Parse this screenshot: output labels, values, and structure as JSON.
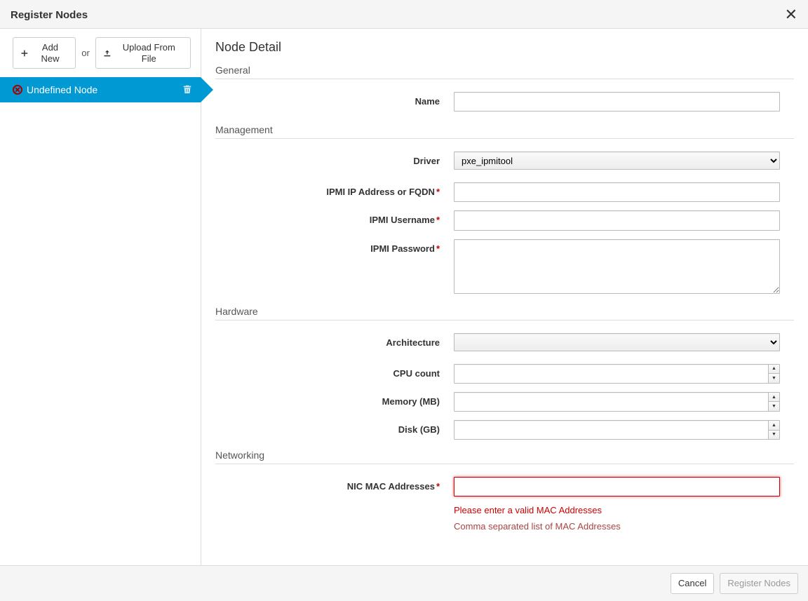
{
  "header": {
    "title": "Register Nodes"
  },
  "sidebar": {
    "add_label": "Add New",
    "or_label": "or",
    "upload_label": "Upload From File",
    "node_label": "Undefined Node"
  },
  "detail": {
    "title": "Node Detail",
    "sections": {
      "general": "General",
      "management": "Management",
      "hardware": "Hardware",
      "networking": "Networking"
    },
    "fields": {
      "name": {
        "label": "Name",
        "value": ""
      },
      "driver": {
        "label": "Driver",
        "value": "pxe_ipmitool"
      },
      "ipmi_address": {
        "label": "IPMI IP Address or FQDN",
        "value": ""
      },
      "ipmi_user": {
        "label": "IPMI Username",
        "value": ""
      },
      "ipmi_pass": {
        "label": "IPMI Password",
        "value": ""
      },
      "arch": {
        "label": "Architecture",
        "value": ""
      },
      "cpu": {
        "label": "CPU count",
        "value": ""
      },
      "memory": {
        "label": "Memory (MB)",
        "value": ""
      },
      "disk": {
        "label": "Disk (GB)",
        "value": ""
      },
      "mac": {
        "label": "NIC MAC Addresses",
        "value": "",
        "error": "Please enter a valid MAC Addresses",
        "help": "Comma separated list of MAC Addresses"
      }
    }
  },
  "footer": {
    "cancel": "Cancel",
    "submit": "Register Nodes"
  }
}
